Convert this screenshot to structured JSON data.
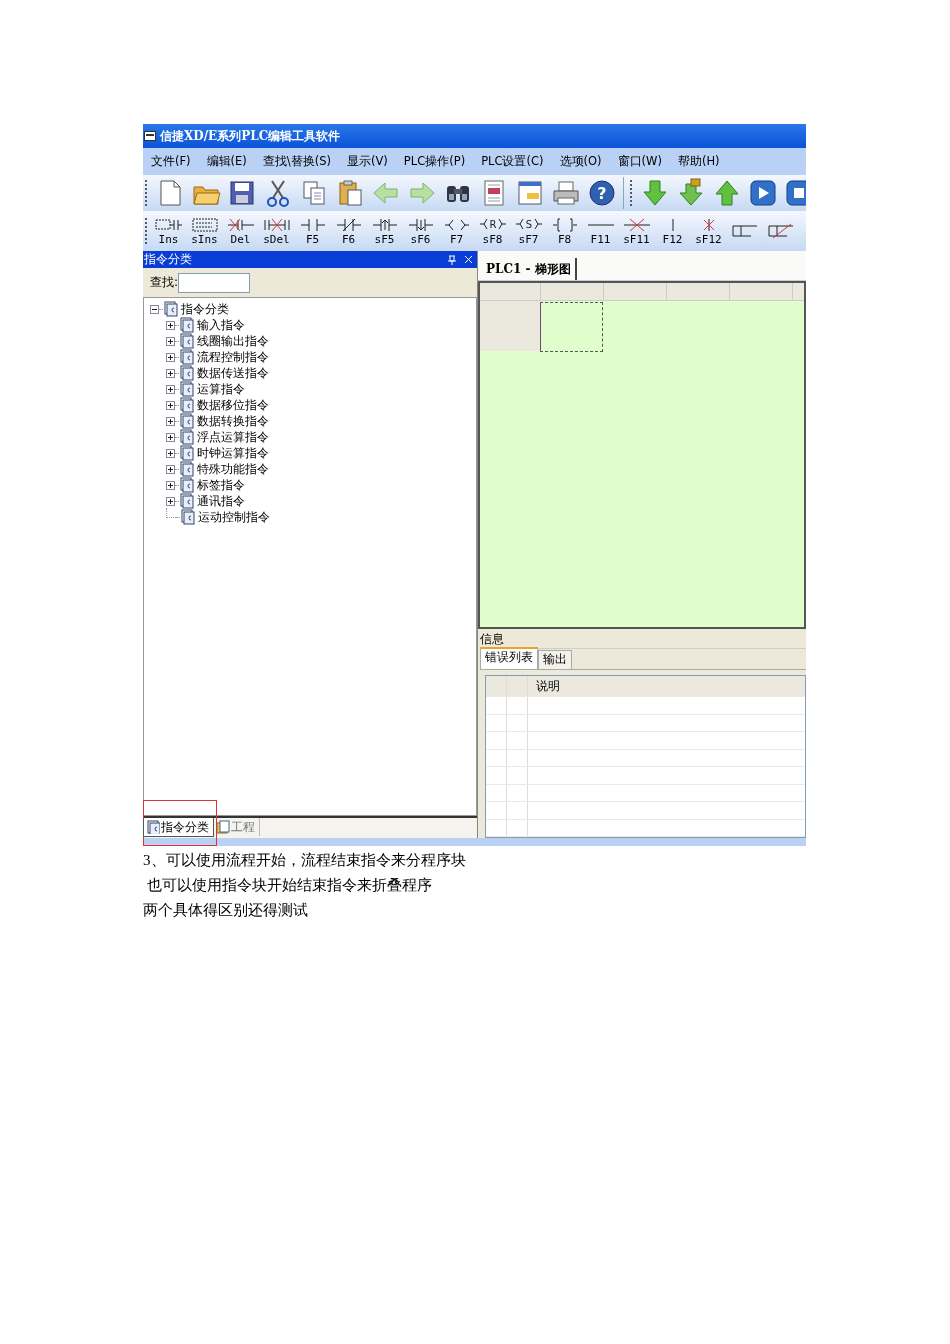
{
  "window": {
    "title": "信捷XD/E系列PLC编辑工具软件"
  },
  "menu": [
    {
      "label": "文件(F)"
    },
    {
      "label": "编辑(E)"
    },
    {
      "label": "查找\\替换(S)"
    },
    {
      "label": "显示(V)"
    },
    {
      "label": "PLC操作(P)"
    },
    {
      "label": "PLC设置(C)"
    },
    {
      "label": "选项(O)"
    },
    {
      "label": "窗口(W)"
    },
    {
      "label": "帮助(H)"
    }
  ],
  "toolbar": [
    {
      "kind": "new"
    },
    {
      "kind": "open"
    },
    {
      "kind": "save"
    },
    {
      "kind": "cut"
    },
    {
      "kind": "copy"
    },
    {
      "kind": "paste"
    },
    {
      "kind": "back"
    },
    {
      "kind": "forward"
    },
    {
      "kind": "find"
    },
    {
      "kind": "document"
    },
    {
      "kind": "window"
    },
    {
      "kind": "print"
    },
    {
      "kind": "help",
      "glyph": "?"
    },
    {
      "kind": "separator"
    },
    {
      "kind": "download"
    },
    {
      "kind": "lock-download"
    },
    {
      "kind": "upload"
    },
    {
      "kind": "run"
    },
    {
      "kind": "stop"
    }
  ],
  "ladder_toolbar": [
    {
      "kind": "ins",
      "label": "Ins"
    },
    {
      "kind": "sins",
      "label": "sIns"
    },
    {
      "kind": "del",
      "label": "Del"
    },
    {
      "kind": "sdel",
      "label": "sDel"
    },
    {
      "kind": "no",
      "label": "F5"
    },
    {
      "kind": "nc",
      "label": "F6"
    },
    {
      "kind": "rise",
      "label": "sF5"
    },
    {
      "kind": "fall",
      "label": "sF6"
    },
    {
      "kind": "coil",
      "label": "F7"
    },
    {
      "kind": "lettercoil",
      "symbol": "R",
      "label": "sF8"
    },
    {
      "kind": "lettercoil",
      "symbol": "S",
      "label": "sF7"
    },
    {
      "kind": "bracket",
      "label": "F8"
    },
    {
      "kind": "hline",
      "label": "F11"
    },
    {
      "kind": "xhline",
      "label": "sF11"
    },
    {
      "kind": "vline",
      "label": "F12"
    },
    {
      "kind": "xvline",
      "label": "sF12"
    },
    {
      "kind": "step"
    },
    {
      "kind": "xstep"
    }
  ],
  "instruction_panel": {
    "title": "指令分类",
    "search_label": "查找:",
    "tree": {
      "label": "指令分类",
      "expandable": true,
      "expanded": true,
      "children": [
        {
          "label": "输入指令",
          "expandable": true,
          "expanded": false
        },
        {
          "label": "线圈输出指令",
          "expandable": true,
          "expanded": false
        },
        {
          "label": "流程控制指令",
          "expandable": true,
          "expanded": false
        },
        {
          "label": "数据传送指令",
          "expandable": true,
          "expanded": false
        },
        {
          "label": "运算指令",
          "expandable": true,
          "expanded": false
        },
        {
          "label": "数据移位指令",
          "expandable": true,
          "expanded": false
        },
        {
          "label": "数据转换指令",
          "expandable": true,
          "expanded": false
        },
        {
          "label": "浮点运算指令",
          "expandable": true,
          "expanded": false
        },
        {
          "label": "时钟运算指令",
          "expandable": true,
          "expanded": false
        },
        {
          "label": "特殊功能指令",
          "expandable": true,
          "expanded": false
        },
        {
          "label": "标签指令",
          "expandable": true,
          "expanded": false
        },
        {
          "label": "通讯指令",
          "expandable": true,
          "expanded": false
        },
        {
          "label": "运动控制指令",
          "expandable": false,
          "expanded": false
        }
      ]
    },
    "tabs": [
      {
        "label": "指令分类",
        "selected": true,
        "highlighted": true
      },
      {
        "label": "工程",
        "selected": false,
        "highlighted": false
      }
    ]
  },
  "editor": {
    "tabs": [
      {
        "label": "PLC1 - 梯形图",
        "selected": true
      }
    ]
  },
  "info_panel": {
    "title": "信息",
    "tabs": [
      {
        "label": "错误列表",
        "selected": true
      },
      {
        "label": "输出",
        "selected": false
      }
    ],
    "columns": [
      {
        "label": "说明"
      }
    ]
  },
  "document_text": [
    "3、可以使用流程开始，流程结束指令来分程序块",
    " 也可以使用指令块开始结束指令来折叠程序",
    "两个具体得区别还得测试"
  ]
}
